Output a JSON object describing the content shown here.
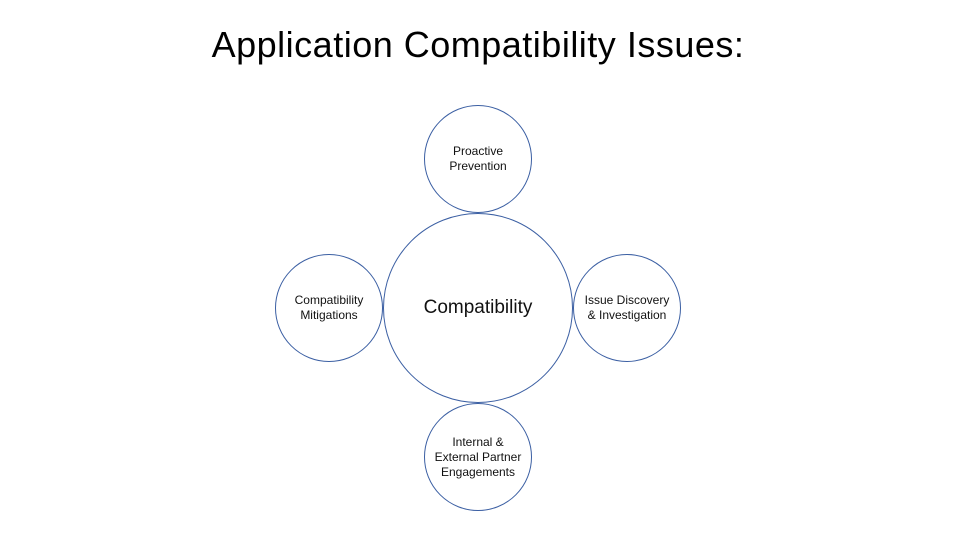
{
  "title": "Application Compatibility Issues:",
  "diagram": {
    "center": "Compatibility",
    "top": "Proactive Prevention",
    "right": "Issue Discovery & Investigation",
    "bottom": "Internal & External Partner Engagements",
    "left": "Compatibility Mitigations"
  }
}
